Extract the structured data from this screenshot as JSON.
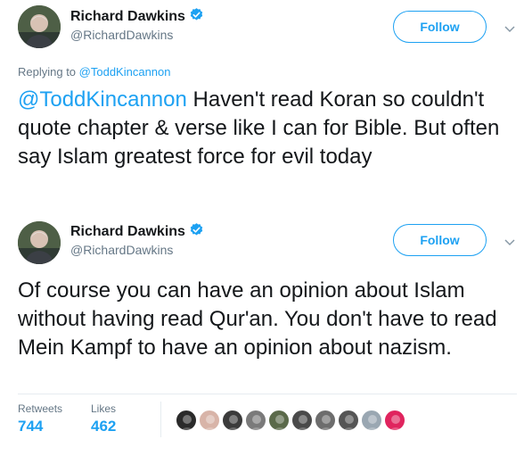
{
  "colors": {
    "accent": "#1da1f2",
    "muted": "#657786",
    "text": "#14171a",
    "verified": "#1da1f2"
  },
  "tweets": [
    {
      "author_name": "Richard Dawkins",
      "author_handle": "@RichardDawkins",
      "follow_label": "Follow",
      "reply_prefix": "Replying to",
      "reply_to": "@ToddKincannon",
      "mention": "@ToddKincannon",
      "body": " Haven't read Koran so couldn't quote chapter & verse like I can for Bible. But often say Islam greatest force for evil today"
    },
    {
      "author_name": "Richard Dawkins",
      "author_handle": "@RichardDawkins",
      "follow_label": "Follow",
      "body": "Of course you can have an opinion about Islam without having read Qur'an. You don't have to read Mein Kampf to have an opinion about nazism."
    }
  ],
  "stats": {
    "retweets_label": "Retweets",
    "retweets_count": "744",
    "likes_label": "Likes",
    "likes_count": "462"
  },
  "likers": [
    {
      "icon": "liker-avatar-1",
      "color": "#2a2a2a"
    },
    {
      "icon": "liker-avatar-2",
      "color": "#d8b4a8"
    },
    {
      "icon": "liker-avatar-3",
      "color": "#3b3b3b"
    },
    {
      "icon": "liker-avatar-4",
      "color": "#7a7a7a"
    },
    {
      "icon": "liker-avatar-5",
      "color": "#5b6a4a"
    },
    {
      "icon": "liker-avatar-6",
      "color": "#4a4a4a"
    },
    {
      "icon": "liker-avatar-7",
      "color": "#6d6d6d"
    },
    {
      "icon": "liker-avatar-8",
      "color": "#555555"
    },
    {
      "icon": "liker-avatar-9",
      "color": "#9aa7b2"
    },
    {
      "icon": "liker-avatar-10",
      "color": "#e0245e"
    }
  ]
}
